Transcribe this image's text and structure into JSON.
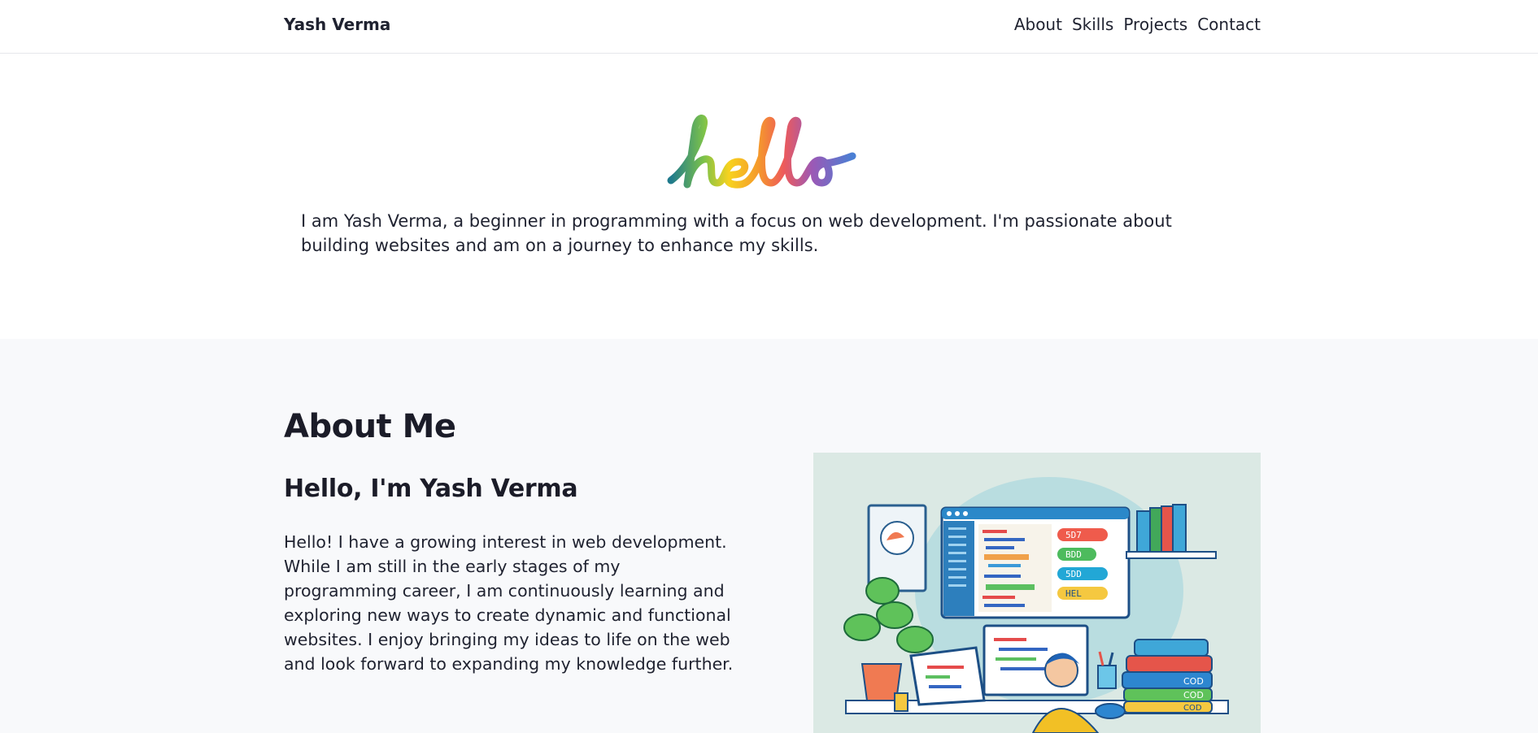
{
  "nav": {
    "brand": "Yash Verma",
    "links": [
      "About",
      "Skills",
      "Projects",
      "Contact"
    ]
  },
  "hero": {
    "logo_text": "hello",
    "intro": "I am Yash Verma, a beginner in programming with a focus on web development. I'm passionate about building websites and am on a journey to enhance my skills."
  },
  "about": {
    "title": "About Me",
    "subtitle": "Hello, I'm Yash Verma",
    "body": "Hello! I have a growing interest in web development. While I am still in the early stages of my programming career, I am continuously learning and exploring new ways to create dynamic and functional websites. I enjoy bringing my ideas to life on the web and look forward to expanding my knowledge further.",
    "illustration": {
      "screen_tags": [
        "5D7",
        "BDD",
        "5DD",
        "HEL"
      ],
      "book_labels": [
        "COD",
        "COD",
        "COD"
      ]
    }
  },
  "colors": {
    "text": "#1f2230",
    "about_bg": "#f8f9fb",
    "illustration_bg": "#dbe9e4"
  }
}
